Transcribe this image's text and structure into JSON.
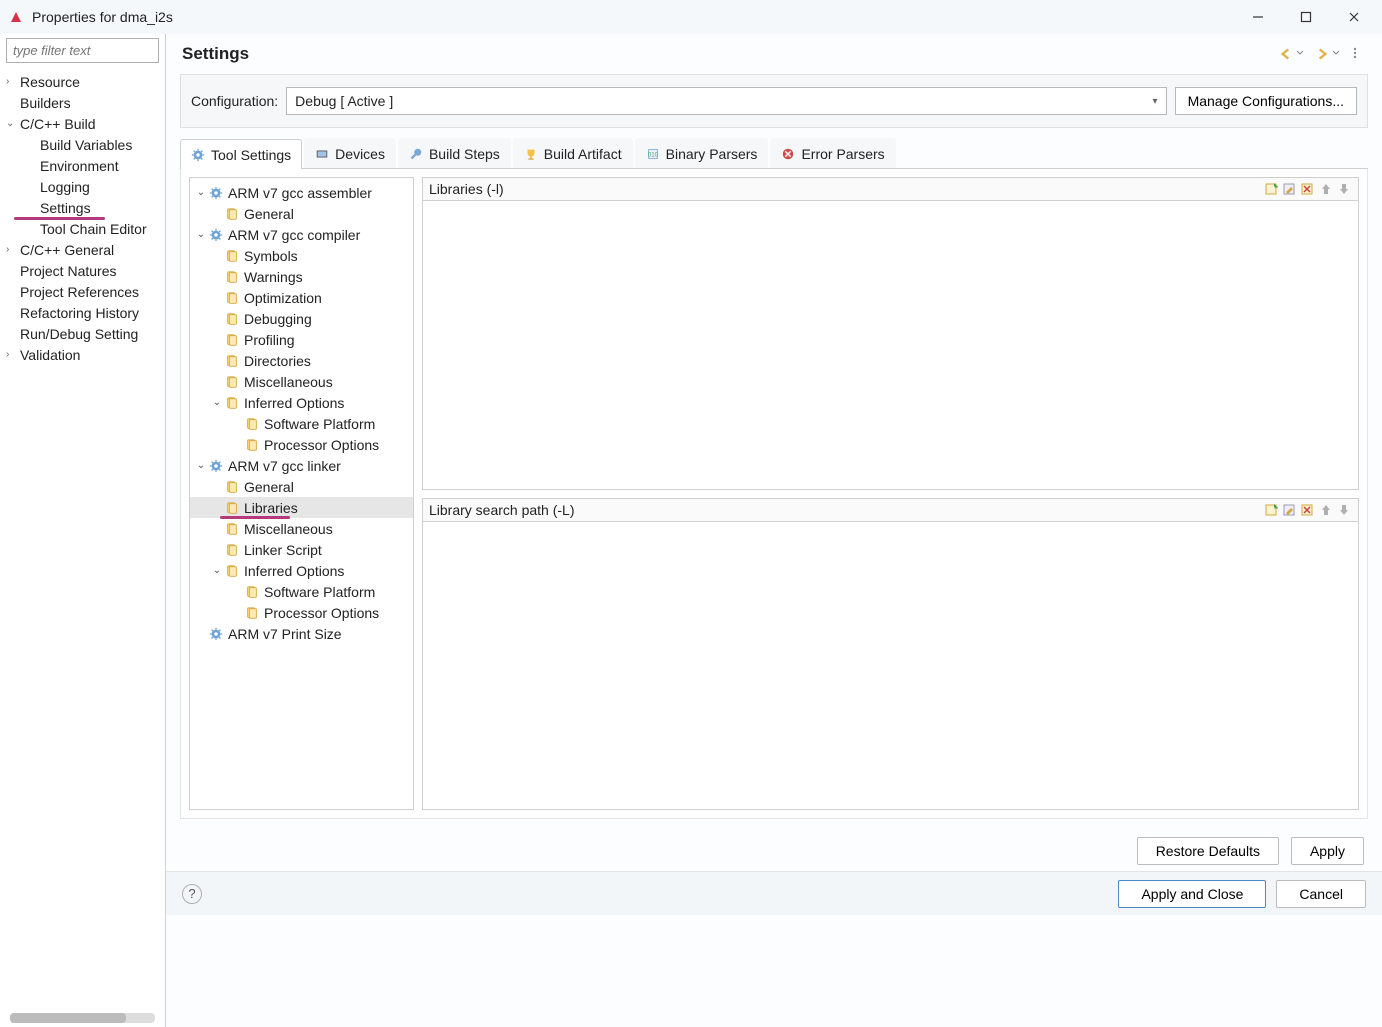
{
  "window": {
    "title": "Properties for dma_i2s"
  },
  "sidebar": {
    "filter_placeholder": "type filter text",
    "items": [
      {
        "label": "Resource",
        "depth": 0,
        "exp": ">"
      },
      {
        "label": "Builders",
        "depth": 0,
        "exp": ""
      },
      {
        "label": "C/C++ Build",
        "depth": 0,
        "exp": "v"
      },
      {
        "label": "Build Variables",
        "depth": 1,
        "exp": ""
      },
      {
        "label": "Environment",
        "depth": 1,
        "exp": ""
      },
      {
        "label": "Logging",
        "depth": 1,
        "exp": ""
      },
      {
        "label": "Settings",
        "depth": 1,
        "exp": "",
        "hl": true
      },
      {
        "label": "Tool Chain Editor",
        "depth": 1,
        "exp": ""
      },
      {
        "label": "C/C++ General",
        "depth": 0,
        "exp": ">"
      },
      {
        "label": "Project Natures",
        "depth": 0,
        "exp": ""
      },
      {
        "label": "Project References",
        "depth": 0,
        "exp": ""
      },
      {
        "label": "Refactoring History",
        "depth": 0,
        "exp": ""
      },
      {
        "label": "Run/Debug Setting",
        "depth": 0,
        "exp": ""
      },
      {
        "label": "Validation",
        "depth": 0,
        "exp": ">"
      }
    ]
  },
  "header": {
    "title": "Settings"
  },
  "config": {
    "label": "Configuration:",
    "value": "Debug  [ Active ]",
    "manage": "Manage Configurations..."
  },
  "tabs": [
    {
      "label": "Tool Settings",
      "active": true
    },
    {
      "label": "Devices"
    },
    {
      "label": "Build Steps"
    },
    {
      "label": "Build Artifact"
    },
    {
      "label": "Binary Parsers"
    },
    {
      "label": "Error Parsers"
    }
  ],
  "tooltree": [
    {
      "d": 0,
      "exp": "v",
      "ic": "cog",
      "label": "ARM v7 gcc assembler"
    },
    {
      "d": 1,
      "exp": "",
      "ic": "page",
      "label": "General"
    },
    {
      "d": 0,
      "exp": "v",
      "ic": "cog",
      "label": "ARM v7 gcc compiler"
    },
    {
      "d": 1,
      "exp": "",
      "ic": "page",
      "label": "Symbols"
    },
    {
      "d": 1,
      "exp": "",
      "ic": "page",
      "label": "Warnings"
    },
    {
      "d": 1,
      "exp": "",
      "ic": "page",
      "label": "Optimization"
    },
    {
      "d": 1,
      "exp": "",
      "ic": "page",
      "label": "Debugging"
    },
    {
      "d": 1,
      "exp": "",
      "ic": "page",
      "label": "Profiling"
    },
    {
      "d": 1,
      "exp": "",
      "ic": "page",
      "label": "Directories"
    },
    {
      "d": 1,
      "exp": "",
      "ic": "page",
      "label": "Miscellaneous"
    },
    {
      "d": 1,
      "exp": "v",
      "ic": "page",
      "label": "Inferred Options"
    },
    {
      "d": 2,
      "exp": "",
      "ic": "page",
      "label": "Software Platform"
    },
    {
      "d": 2,
      "exp": "",
      "ic": "page",
      "label": "Processor Options"
    },
    {
      "d": 0,
      "exp": "v",
      "ic": "cog",
      "label": "ARM v7 gcc linker"
    },
    {
      "d": 1,
      "exp": "",
      "ic": "page",
      "label": "General"
    },
    {
      "d": 1,
      "exp": "",
      "ic": "page",
      "label": "Libraries",
      "sel": true,
      "hl": true
    },
    {
      "d": 1,
      "exp": "",
      "ic": "page",
      "label": "Miscellaneous"
    },
    {
      "d": 1,
      "exp": "",
      "ic": "page",
      "label": "Linker Script"
    },
    {
      "d": 1,
      "exp": "v",
      "ic": "page",
      "label": "Inferred Options"
    },
    {
      "d": 2,
      "exp": "",
      "ic": "page",
      "label": "Software Platform"
    },
    {
      "d": 2,
      "exp": "",
      "ic": "page",
      "label": "Processor Options"
    },
    {
      "d": 0,
      "exp": "",
      "ic": "cog",
      "label": "ARM v7 Print Size"
    }
  ],
  "panels": {
    "p1": "Libraries (-l)",
    "p2": "Library search path (-L)"
  },
  "buttons": {
    "restore": "Restore Defaults",
    "apply": "Apply",
    "apply_close": "Apply and Close",
    "cancel": "Cancel"
  }
}
